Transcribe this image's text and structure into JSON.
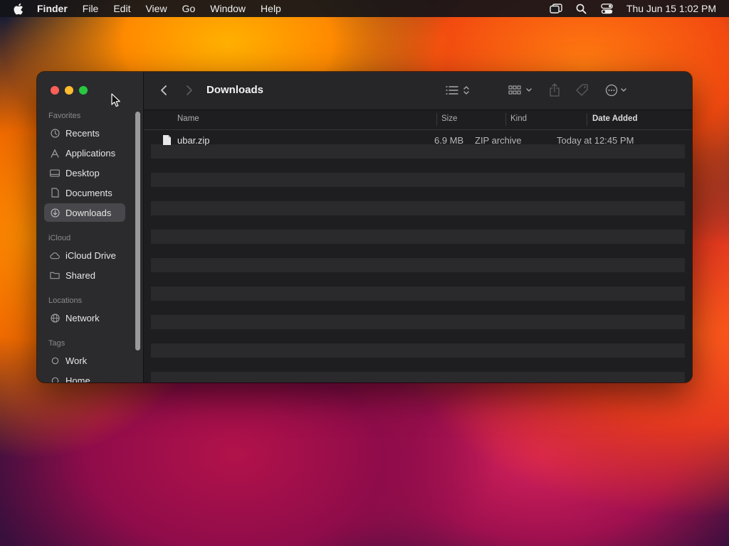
{
  "menubar": {
    "app_name": "Finder",
    "menus": [
      "File",
      "Edit",
      "View",
      "Go",
      "Window",
      "Help"
    ],
    "clock": "Thu Jun 15  1:02 PM"
  },
  "window": {
    "title": "Downloads",
    "sidebar": {
      "favorites_label": "Favorites",
      "favorites": [
        {
          "label": "Recents",
          "icon": "clock-icon"
        },
        {
          "label": "Applications",
          "icon": "applications-icon"
        },
        {
          "label": "Desktop",
          "icon": "desktop-icon"
        },
        {
          "label": "Documents",
          "icon": "document-icon"
        },
        {
          "label": "Downloads",
          "icon": "download-icon",
          "selected": true
        }
      ],
      "icloud_label": "iCloud",
      "icloud": [
        {
          "label": "iCloud Drive",
          "icon": "cloud-icon"
        },
        {
          "label": "Shared",
          "icon": "shared-folder-icon"
        }
      ],
      "locations_label": "Locations",
      "locations": [
        {
          "label": "Network",
          "icon": "globe-icon"
        }
      ],
      "tags_label": "Tags",
      "tags": [
        {
          "label": "Work",
          "icon": "tag-circle-icon"
        },
        {
          "label": "Home",
          "icon": "tag-circle-icon"
        }
      ]
    },
    "columns": {
      "name": "Name",
      "size": "Size",
      "kind": "Kind",
      "date_added": "Date Added"
    },
    "files": [
      {
        "name": "ubar.zip",
        "size": "6.9 MB",
        "kind": "ZIP archive",
        "date_added": "Today at 12:45 PM"
      }
    ]
  }
}
